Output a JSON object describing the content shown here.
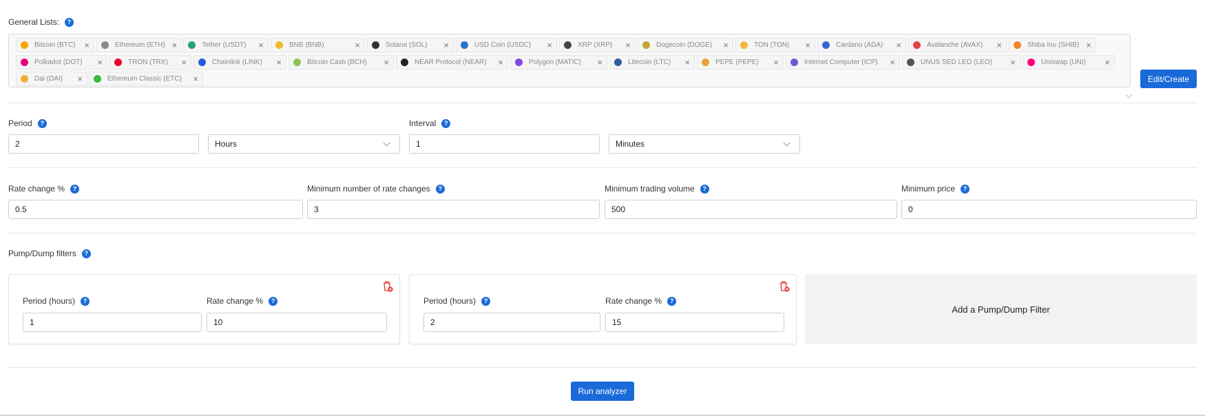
{
  "general_lists": {
    "label": "General Lists:",
    "edit_button": "Edit/Create",
    "tags": [
      {
        "label": "Bitcoin (BTC)",
        "color": "#f7a600"
      },
      {
        "label": "Ethereum (ETH)",
        "color": "#8a8a8a"
      },
      {
        "label": "Tether (USDT)",
        "color": "#26a17b"
      },
      {
        "label": "BNB (BNB)",
        "color": "#f3ba2f"
      },
      {
        "label": "Solana (SOL)",
        "color": "#333333"
      },
      {
        "label": "USD Coin (USDC)",
        "color": "#2775ca"
      },
      {
        "label": "XRP (XRP)",
        "color": "#444444"
      },
      {
        "label": "Dogecoin (DOGE)",
        "color": "#c2a633"
      },
      {
        "label": "TON (TON)",
        "color": "#f5b942"
      },
      {
        "label": "Cardano (ADA)",
        "color": "#3468d1"
      },
      {
        "label": "Avalanche (AVAX)",
        "color": "#e84142"
      },
      {
        "label": "Shiba Inu (SHIB)",
        "color": "#f0852d"
      },
      {
        "label": "Polkadot (DOT)",
        "color": "#e6007a"
      },
      {
        "label": "TRON (TRX)",
        "color": "#eb0029"
      },
      {
        "label": "Chainlink (LINK)",
        "color": "#2a5ada"
      },
      {
        "label": "Bitcoin Cash (BCH)",
        "color": "#8dc351"
      },
      {
        "label": "NEAR Protocol (NEAR)",
        "color": "#222222"
      },
      {
        "label": "Polygon (MATIC)",
        "color": "#8247e5"
      },
      {
        "label": "Litecoin (LTC)",
        "color": "#345d9d"
      },
      {
        "label": "PEPE (PEPE)",
        "color": "#e8a33b"
      },
      {
        "label": "Internet Computer (ICP)",
        "color": "#6d5bd0"
      },
      {
        "label": "UNUS SED LEO (LEO)",
        "color": "#555555"
      },
      {
        "label": "Uniswap (UNI)",
        "color": "#ff007a"
      },
      {
        "label": "Dai (DAI)",
        "color": "#f5ac37"
      },
      {
        "label": "Ethereum Classic (ETC)",
        "color": "#3ab83a"
      }
    ]
  },
  "period": {
    "label": "Period",
    "value": "2",
    "unit": "Hours"
  },
  "interval": {
    "label": "Interval",
    "value": "1",
    "unit": "Minutes"
  },
  "thresholds": {
    "rate_change": {
      "label": "Rate change %",
      "value": "0.5"
    },
    "min_rate_changes": {
      "label": "Minimum number of rate changes",
      "value": "3"
    },
    "min_volume": {
      "label": "Minimum trading volume",
      "value": "500"
    },
    "min_price": {
      "label": "Minimum price",
      "value": "0"
    }
  },
  "pump_dump": {
    "label": "Pump/Dump filters",
    "filters": [
      {
        "period_label": "Period (hours)",
        "period_value": "1",
        "rate_label": "Rate change %",
        "rate_value": "10"
      },
      {
        "period_label": "Period (hours)",
        "period_value": "2",
        "rate_label": "Rate change %",
        "rate_value": "15"
      }
    ],
    "add_label": "Add a Pump/Dump Filter"
  },
  "run_button": "Run analyzer",
  "help_glyph": "?",
  "close_glyph": "×",
  "colors": {
    "accent": "#1a6ad9",
    "danger": "#e0342b"
  }
}
